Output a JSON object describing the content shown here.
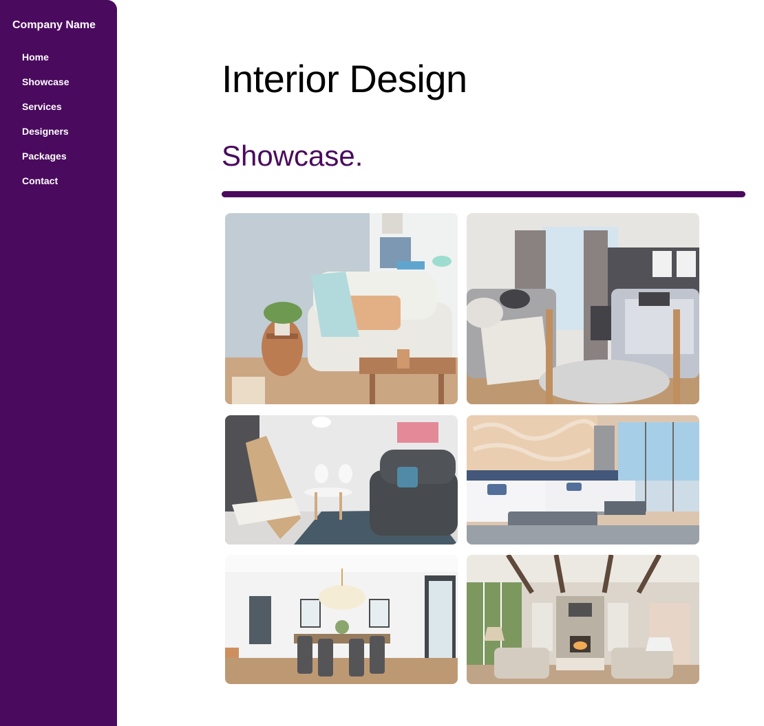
{
  "sidebar": {
    "brand": "Company Name",
    "items": [
      {
        "label": "Home"
      },
      {
        "label": "Showcase"
      },
      {
        "label": "Services"
      },
      {
        "label": "Designers"
      },
      {
        "label": "Packages"
      },
      {
        "label": "Contact"
      }
    ]
  },
  "main": {
    "title": "Interior Design",
    "subtitle": "Showcase."
  },
  "colors": {
    "accent": "#4a0a5e"
  },
  "gallery": {
    "photos": [
      {
        "name": "living-room-armchair-photo"
      },
      {
        "name": "dorm-bedroom-photo"
      },
      {
        "name": "dining-lounge-photo"
      },
      {
        "name": "hotel-bedroom-photo"
      },
      {
        "name": "dining-room-photo"
      },
      {
        "name": "great-room-fireplace-photo"
      }
    ]
  }
}
